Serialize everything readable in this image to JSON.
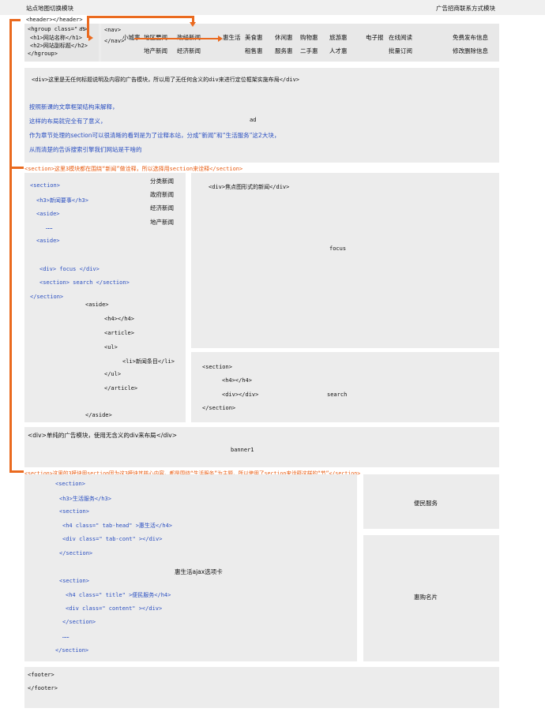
{
  "topbar": {
    "left": "站点地图切换模块",
    "right": "广告招商联系方式模块"
  },
  "header": {
    "tag": "<header></header>",
    "hgroup_lines": [
      "<hgroup class=\"     \">",
      "<h1>网站名称</h1>",
      "<h2>网站副标题</h2>",
      "</hgroup>"
    ],
    "hgroup_attr": "as",
    "nav_lines": [
      "<nav>",
      "</nav>"
    ]
  },
  "nav": {
    "col_a": [
      "小城事",
      ""
    ],
    "col_b": [
      "地区要闻",
      "地产新闻"
    ],
    "col_c": [
      "政经新闻",
      "经济新闻"
    ],
    "col_d": [
      "惠生活",
      ""
    ],
    "col_e": [
      "美食惠",
      "租售惠"
    ],
    "col_f": [
      "休闲惠",
      "服务惠"
    ],
    "col_g": [
      "购物惠",
      "二手惠"
    ],
    "col_h": [
      "旅游惠",
      "人才惠"
    ],
    "col_i": [
      "电子报",
      ""
    ],
    "col_j": [
      "在线阅读",
      "批量订阅"
    ],
    "col_k": [
      "免费发布信息",
      "修改删除信息"
    ]
  },
  "intro": {
    "line1": "<div>这里是无任何标题说明及内容的广告模块，所以用了无任何含义的div来进行定位框架实施布局</div>",
    "line2": "按照新课的文章框架结构来解释，",
    "line3": "这样的布局就完全有了意义，",
    "ad": "ad",
    "line4": "作为章节处理的section可以很清晰的看到是为了诠释本站，分成“新闻”和“生活服务”这2大块，",
    "line5": "从而清楚的告诉搜索引擎我们网站是干啥的"
  },
  "section1_note": "<section>这里3模块都在围绕“新闻”做诠释，所以选择用section来诠释</section>",
  "left_panel": {
    "code": [
      "<section>",
      "<h3>新闻要事</h3>",
      "<aside>",
      "……",
      "<aside>",
      "<div> focus </div>",
      "<section> search </section>",
      "</section>"
    ],
    "menu": [
      "分类新闻",
      "政府新闻",
      "经济新闻",
      "地产新闻"
    ],
    "aside_code": [
      "<aside>",
      "<h4></h4>",
      "<article>",
      "<ul>",
      "<li>新闻条目</li>",
      "</ul>",
      "</article>",
      "</aside>"
    ]
  },
  "focus": {
    "title": "<div>焦点图形式的新闻</div>",
    "label": "focus"
  },
  "search": {
    "code": [
      "<section>",
      "<h4></h4>",
      "<div></div>",
      "</section>"
    ],
    "label": "search"
  },
  "banner": {
    "title": "<div>单纯的广告模块，使用无含义的div来布局</div>",
    "label": "banner1"
  },
  "section2_note": "<section>这里的3模块用section因为这3模块其核心内容，都是围绕“生活服务”为主题，所以使用了section来诠释这样的“节”</section>",
  "life": {
    "code": [
      "<section>",
      "<h3>生活服务</h3>",
      "<section>",
      "<h4 class=\" tab-head\" >惠生活</h4>",
      "<div class=\" tab-cont\" ></div>",
      "</section>",
      "<section>",
      "<h4 class=\" title\" >便民服务</h4>",
      "<div class=\" content\" ></div>",
      "</section>",
      "……",
      "</section>"
    ],
    "center": "惠生活ajax选项卡"
  },
  "side_boxes": {
    "service": "便民服务",
    "card": "惠购名片"
  },
  "footer": {
    "lines": [
      "<footer>",
      "</footer>"
    ]
  },
  "colors": {
    "box": "#ececec",
    "blue": "#2a4fc1",
    "orange": "#e85b10"
  }
}
